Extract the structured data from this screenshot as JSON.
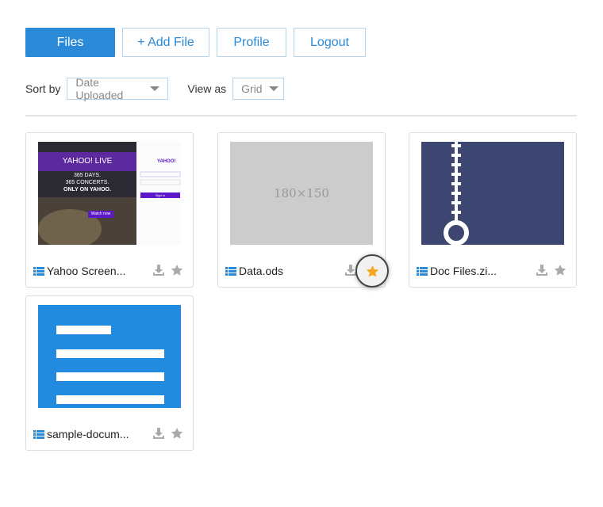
{
  "nav": {
    "files": "Files",
    "add_file": "+ Add File",
    "profile": "Profile",
    "logout": "Logout"
  },
  "sort": {
    "label": "Sort by",
    "value": "Date Uploaded"
  },
  "view": {
    "label": "View as",
    "value": "Grid"
  },
  "placeholder_text": "180×150",
  "yahoo_thumb": {
    "logo": "YAHOO! LIVE",
    "lines": [
      "365 DAYS.",
      "365 CONCERTS.",
      "ONLY ON YAHOO."
    ],
    "cta": "Watch now",
    "signin_logo": "YAHOO!",
    "signin_button": "Sign in"
  },
  "files": [
    {
      "name": "Yahoo Screen...",
      "starred": false
    },
    {
      "name": "Data.ods",
      "starred": true
    },
    {
      "name": "Doc Files.zi...",
      "starred": false
    },
    {
      "name": "sample-docum...",
      "starred": false
    }
  ],
  "colors": {
    "accent": "#2b8ad8",
    "star_active": "#f5a623",
    "icon_gray": "#aaaaaa",
    "zip_bg": "#3d4670",
    "doc_bg": "#228be0"
  }
}
